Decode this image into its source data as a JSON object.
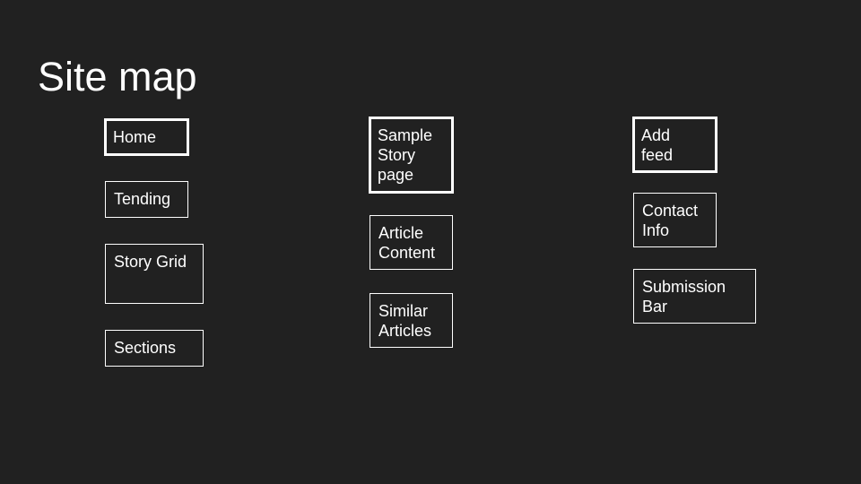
{
  "title": "Site map",
  "columns": [
    {
      "items": [
        {
          "label": "Home"
        },
        {
          "label": "Tending"
        },
        {
          "label": "Story Grid"
        },
        {
          "label": "Sections"
        }
      ]
    },
    {
      "items": [
        {
          "label": "Sample\nStory\npage"
        },
        {
          "label": "Article\nContent"
        },
        {
          "label": "Similar\nArticles"
        }
      ]
    },
    {
      "items": [
        {
          "label": "Add\nfeed"
        },
        {
          "label": "Contact\nInfo"
        },
        {
          "label": "Submission\nBar"
        }
      ]
    }
  ],
  "colors": {
    "background": "#212121",
    "foreground": "#ffffff"
  }
}
